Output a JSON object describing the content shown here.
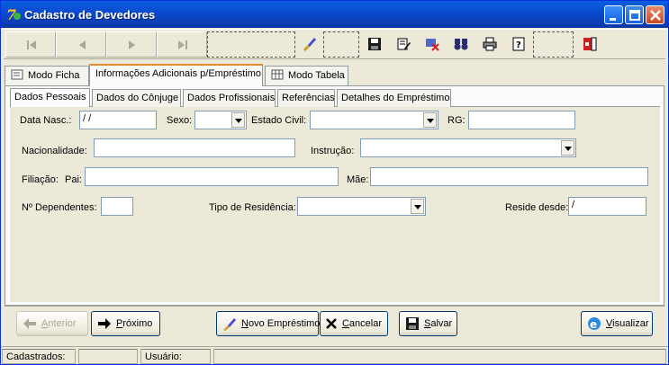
{
  "window": {
    "title": "Cadastro de Devedores",
    "title_color": "#0a4bd0"
  },
  "tabs": [
    {
      "label": "Modo Ficha",
      "icon": "card-icon"
    },
    {
      "label": "Informações Adicionais p/Empréstimo",
      "active": true
    },
    {
      "label": "Modo Tabela",
      "icon": "grid-icon"
    }
  ],
  "subtabs": [
    {
      "label": "Dados Pessoais",
      "active": true
    },
    {
      "label": "Dados do Cônjuge"
    },
    {
      "label": "Dados Profissionais"
    },
    {
      "label": "Referências"
    },
    {
      "label": "Detalhes do Empréstimo"
    }
  ],
  "form": {
    "data_nasc": {
      "label": "Data Nasc.:",
      "value": " /  /"
    },
    "sexo": {
      "label": "Sexo:",
      "value": ""
    },
    "estado_civil": {
      "label": "Estado Civil:",
      "value": ""
    },
    "rg": {
      "label": "RG:",
      "value": ""
    },
    "nacionalidade": {
      "label": "Nacionalidade:",
      "value": ""
    },
    "instrucao": {
      "label": "Instrução:",
      "value": ""
    },
    "filiacao": {
      "label": "Filiação:",
      "pai_label": "Pai:",
      "pai_value": "",
      "mae_label": "Mãe:",
      "mae_value": ""
    },
    "dependentes": {
      "label": "Nº Dependentes:",
      "value": ""
    },
    "tipo_residencia": {
      "label": "Tipo de Residência:",
      "value": ""
    },
    "reside_desde": {
      "label": "Reside desde:",
      "value": " /"
    }
  },
  "buttons": {
    "anterior": {
      "pre": "",
      "u": "A",
      "post": "nterior"
    },
    "proximo": {
      "pre": "",
      "u": "P",
      "post": "róximo"
    },
    "novo": {
      "pre": "",
      "u": "N",
      "post": "ovo Empréstimo"
    },
    "cancelar": {
      "pre": "",
      "u": "C",
      "post": "ancelar"
    },
    "salvar": {
      "pre": "",
      "u": "S",
      "post": "alvar"
    },
    "visualizar": {
      "pre": "",
      "u": "V",
      "post": "isualizar"
    }
  },
  "status": {
    "cadastrados": "Cadastrados:",
    "usuario": "Usuário:"
  }
}
